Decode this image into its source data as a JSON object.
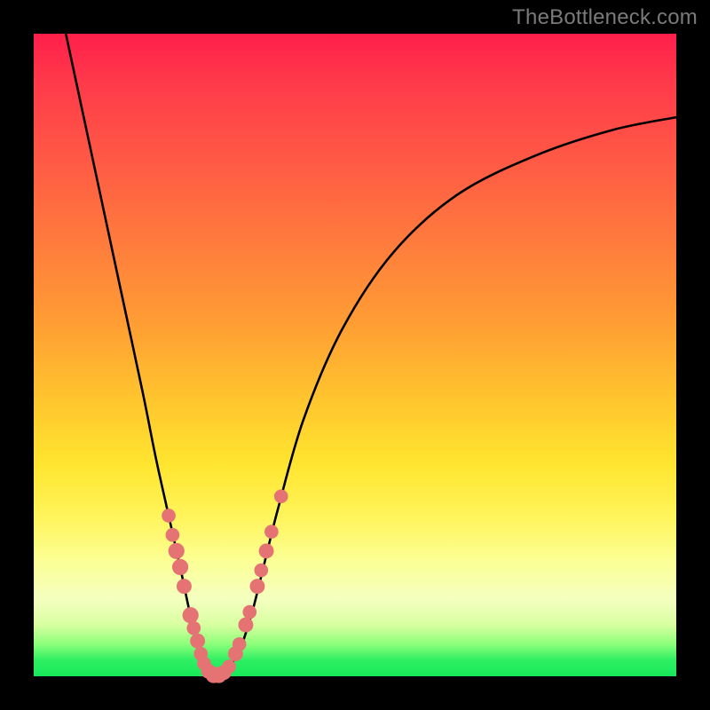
{
  "watermark": "TheBottleneck.com",
  "colors": {
    "frame": "#000000",
    "gradient_top": "#ff1f4a",
    "gradient_bottom": "#16e85a",
    "curve": "#000000",
    "dots": "#e57373"
  },
  "chart_data": {
    "type": "line",
    "title": "",
    "xlabel": "",
    "ylabel": "",
    "xlim": [
      0,
      100
    ],
    "ylim": [
      0,
      100
    ],
    "series": [
      {
        "name": "bottleneck-curve",
        "x": [
          5,
          8,
          11,
          14,
          17,
          19,
          21,
          23,
          24.5,
          26,
          27,
          28,
          29,
          30,
          32,
          34,
          36,
          38,
          42,
          48,
          56,
          66,
          78,
          90,
          100
        ],
        "y": [
          100,
          86,
          72,
          58,
          44,
          34,
          25,
          16,
          9,
          4,
          1,
          0,
          0,
          1,
          4,
          10,
          18,
          26,
          40,
          54,
          66,
          75,
          81,
          85,
          87
        ]
      }
    ],
    "scatter": {
      "name": "highlight-points",
      "points": [
        {
          "x": 21.0,
          "y": 25.0,
          "r": 1.2
        },
        {
          "x": 21.6,
          "y": 22.0,
          "r": 1.2
        },
        {
          "x": 22.2,
          "y": 19.5,
          "r": 1.4
        },
        {
          "x": 22.8,
          "y": 17.0,
          "r": 1.4
        },
        {
          "x": 23.4,
          "y": 14.0,
          "r": 1.3
        },
        {
          "x": 24.4,
          "y": 9.5,
          "r": 1.4
        },
        {
          "x": 24.9,
          "y": 7.5,
          "r": 1.2
        },
        {
          "x": 25.5,
          "y": 5.5,
          "r": 1.3
        },
        {
          "x": 26.0,
          "y": 3.5,
          "r": 1.2
        },
        {
          "x": 26.5,
          "y": 2.0,
          "r": 1.2
        },
        {
          "x": 27.2,
          "y": 0.8,
          "r": 1.3
        },
        {
          "x": 28.0,
          "y": 0.2,
          "r": 1.4
        },
        {
          "x": 28.8,
          "y": 0.2,
          "r": 1.4
        },
        {
          "x": 29.6,
          "y": 0.6,
          "r": 1.3
        },
        {
          "x": 30.4,
          "y": 1.5,
          "r": 1.2
        },
        {
          "x": 31.4,
          "y": 3.5,
          "r": 1.3
        },
        {
          "x": 32.0,
          "y": 5.0,
          "r": 1.2
        },
        {
          "x": 33.0,
          "y": 8.0,
          "r": 1.3
        },
        {
          "x": 33.6,
          "y": 10.0,
          "r": 1.2
        },
        {
          "x": 34.8,
          "y": 14.0,
          "r": 1.3
        },
        {
          "x": 35.4,
          "y": 16.5,
          "r": 1.2
        },
        {
          "x": 36.2,
          "y": 19.5,
          "r": 1.3
        },
        {
          "x": 37.0,
          "y": 22.5,
          "r": 1.2
        },
        {
          "x": 38.5,
          "y": 28.0,
          "r": 1.2
        }
      ]
    }
  }
}
